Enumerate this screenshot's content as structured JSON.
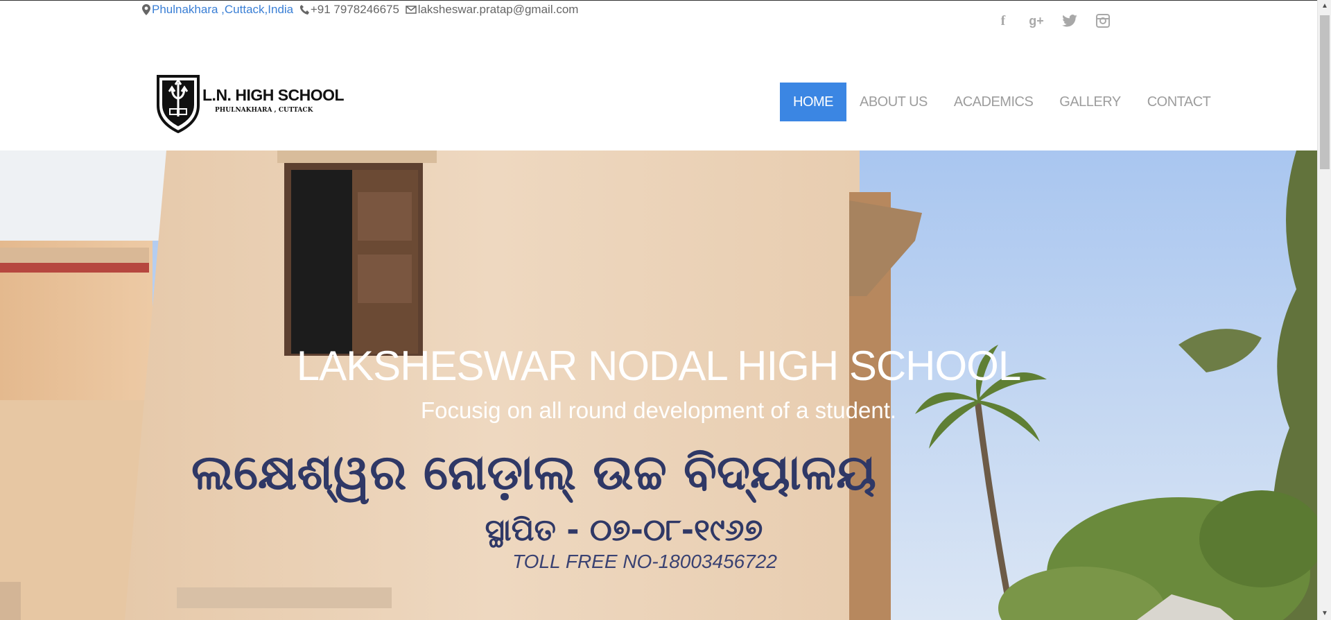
{
  "topbar": {
    "location": "Phulnakhara ,Cuttack,India",
    "phone": "+91 7978246675",
    "email": "laksheswar.pratap@gmail.com"
  },
  "social": {
    "icons": [
      "facebook-icon",
      "google-plus-icon",
      "twitter-icon",
      "instagram-icon"
    ],
    "facebook": "f",
    "googleplus": "g+"
  },
  "logo": {
    "title": "L.N. HIGH SCHOOL",
    "subtitle": "PHULNAKHARA , CUTTACK"
  },
  "nav": {
    "items": [
      {
        "label": "HOME",
        "active": true
      },
      {
        "label": "ABOUT US"
      },
      {
        "label": "ACADEMICS"
      },
      {
        "label": "GALLERY"
      },
      {
        "label": "CONTACT"
      }
    ]
  },
  "hero": {
    "title": "LAKSHESWAR NODAL HIGH SCHOOL",
    "subtitle": "Focusig on all round development of a student.",
    "wall_text_line1": "ଲକ୍ଷେଶ୍ୱର ନୋଡ଼ାଲ୍ ଉଚ୍ଚ ବିଦ୍ୟାଳୟ",
    "wall_text_line2": "ସ୍ଥାପିତ - ୦୭-୦୮-୧୯୬୭",
    "toll_free": "TOLL FREE NO-18003456722"
  },
  "colors": {
    "accent": "#3b86e3",
    "link": "#3a7fd5",
    "nav_text": "#9d9d9d"
  }
}
